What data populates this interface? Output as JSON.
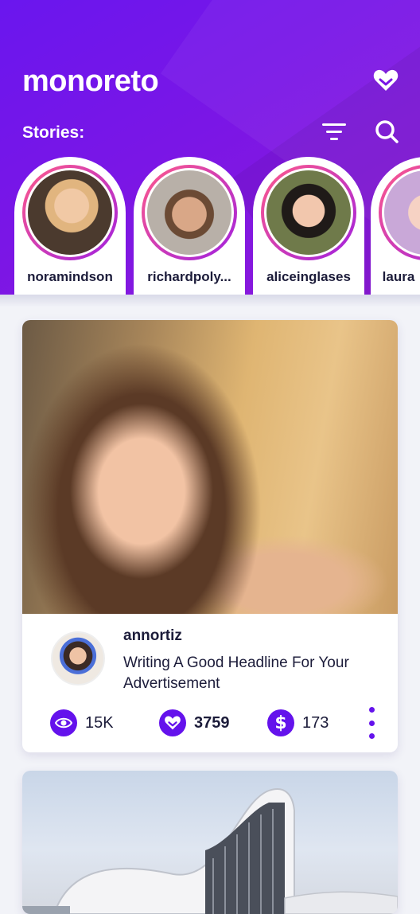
{
  "app": {
    "logo_text": "monoreto"
  },
  "header": {
    "heart_icon": "heart-icon",
    "stories_label": "Stories:",
    "filter_icon": "filter-icon",
    "search_icon": "search-icon"
  },
  "stories": [
    {
      "name": "noramindson"
    },
    {
      "name": "richardpoly..."
    },
    {
      "name": "aliceinglases"
    },
    {
      "name": "laura"
    }
  ],
  "posts": [
    {
      "author": "annortiz",
      "headline": "Writing A Good Headline For Your Advertisement",
      "stats": {
        "views": "15K",
        "likes": "3759",
        "earnings": "173"
      }
    }
  ],
  "colors": {
    "accent": "#6412ec",
    "header_start": "#6a16ee",
    "header_end": "#8e1ad8",
    "text_dark": "#1c1c3a"
  }
}
